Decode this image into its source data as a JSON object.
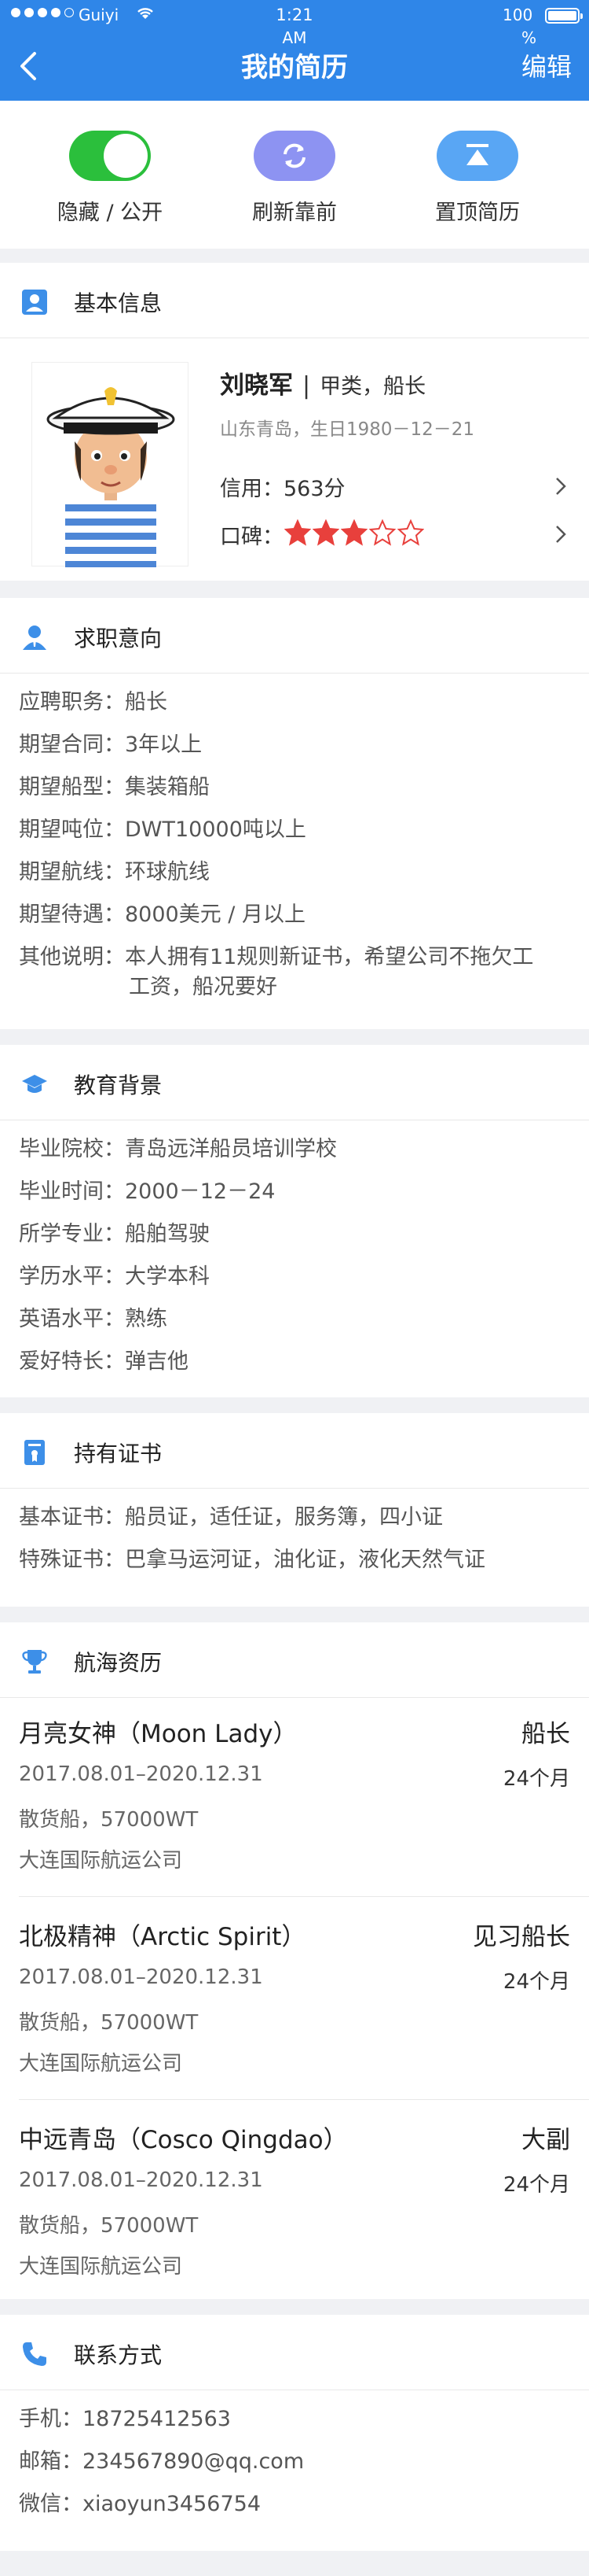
{
  "status": {
    "carrier": "Guiyi",
    "time": "1:21",
    "ampm": "AM",
    "battery": "100",
    "pct": "%"
  },
  "nav": {
    "title": "我的简历",
    "edit": "编辑"
  },
  "actions": {
    "hide": "隐藏 / 公开",
    "refresh": "刷新靠前",
    "top": "置顶简历",
    "hide_toggle_on": true
  },
  "basic": {
    "title": "基本信息",
    "name": "刘晓军",
    "sep": "|",
    "role": "甲类，船长",
    "place": "山东青岛，生日1980－12－21",
    "credit": "信用：563分",
    "reputation_label": "口碑：",
    "reputation_stars": 3,
    "reputation_max": 5
  },
  "job": {
    "title": "求职意向",
    "rows": [
      {
        "k": "应聘职务：",
        "v": "船长"
      },
      {
        "k": "期望合同：",
        "v": "3年以上"
      },
      {
        "k": "期望船型：",
        "v": "集装箱船"
      },
      {
        "k": "期望吨位：",
        "v": "DWT10000吨以上"
      },
      {
        "k": "期望航线：",
        "v": "环球航线"
      },
      {
        "k": "期望待遇：",
        "v": "8000美元 / 月以上"
      },
      {
        "k": "其他说明：",
        "v": "本人拥有11规则新证书，希望公司不拖欠工",
        "v2": "工资，船况要好"
      }
    ]
  },
  "edu": {
    "title": "教育背景",
    "rows": [
      {
        "k": "毕业院校：",
        "v": "青岛远洋船员培训学校"
      },
      {
        "k": "毕业时间：",
        "v": "2000－12－24"
      },
      {
        "k": "所学专业：",
        "v": "船舶驾驶"
      },
      {
        "k": "学历水平：",
        "v": "大学本科"
      },
      {
        "k": "英语水平：",
        "v": "熟练"
      },
      {
        "k": "爱好特长：",
        "v": "弹吉他"
      }
    ]
  },
  "cert": {
    "title": "持有证书",
    "rows": [
      {
        "k": "基本证书：",
        "v": "船员证，适任证，服务簿，四小证"
      },
      {
        "k": "特殊证书：",
        "v": "巴拿马运河证，油化证，液化天然气证"
      }
    ]
  },
  "sea": {
    "title": "航海资历",
    "items": [
      {
        "ship": "月亮女神（Moon Lady）",
        "rank": "船长",
        "date": "2017.08.01–2020.12.31",
        "months": "24个月",
        "type": "散货船，57000WT",
        "company": "大连国际航运公司"
      },
      {
        "ship": "北极精神（Arctic Spirit）",
        "rank": "见习船长",
        "date": "2017.08.01–2020.12.31",
        "months": "24个月",
        "type": "散货船，57000WT",
        "company": "大连国际航运公司"
      },
      {
        "ship": "中远青岛（Cosco Qingdao）",
        "rank": "大副",
        "date": "2017.08.01–2020.12.31",
        "months": "24个月",
        "type": "散货船，57000WT",
        "company": "大连国际航运公司"
      }
    ]
  },
  "contact": {
    "title": "联系方式",
    "rows": [
      {
        "k": "手机：",
        "v": "18725412563"
      },
      {
        "k": "邮箱：",
        "v": "234567890@qq.com"
      },
      {
        "k": "微信：",
        "v": "xiaoyun3456754"
      }
    ]
  },
  "colors": {
    "primary": "#2f86e8",
    "toggle": "#2bbf3c",
    "refresh": "#8d93f2",
    "top": "#59a6f4",
    "star": "#e8403c"
  }
}
